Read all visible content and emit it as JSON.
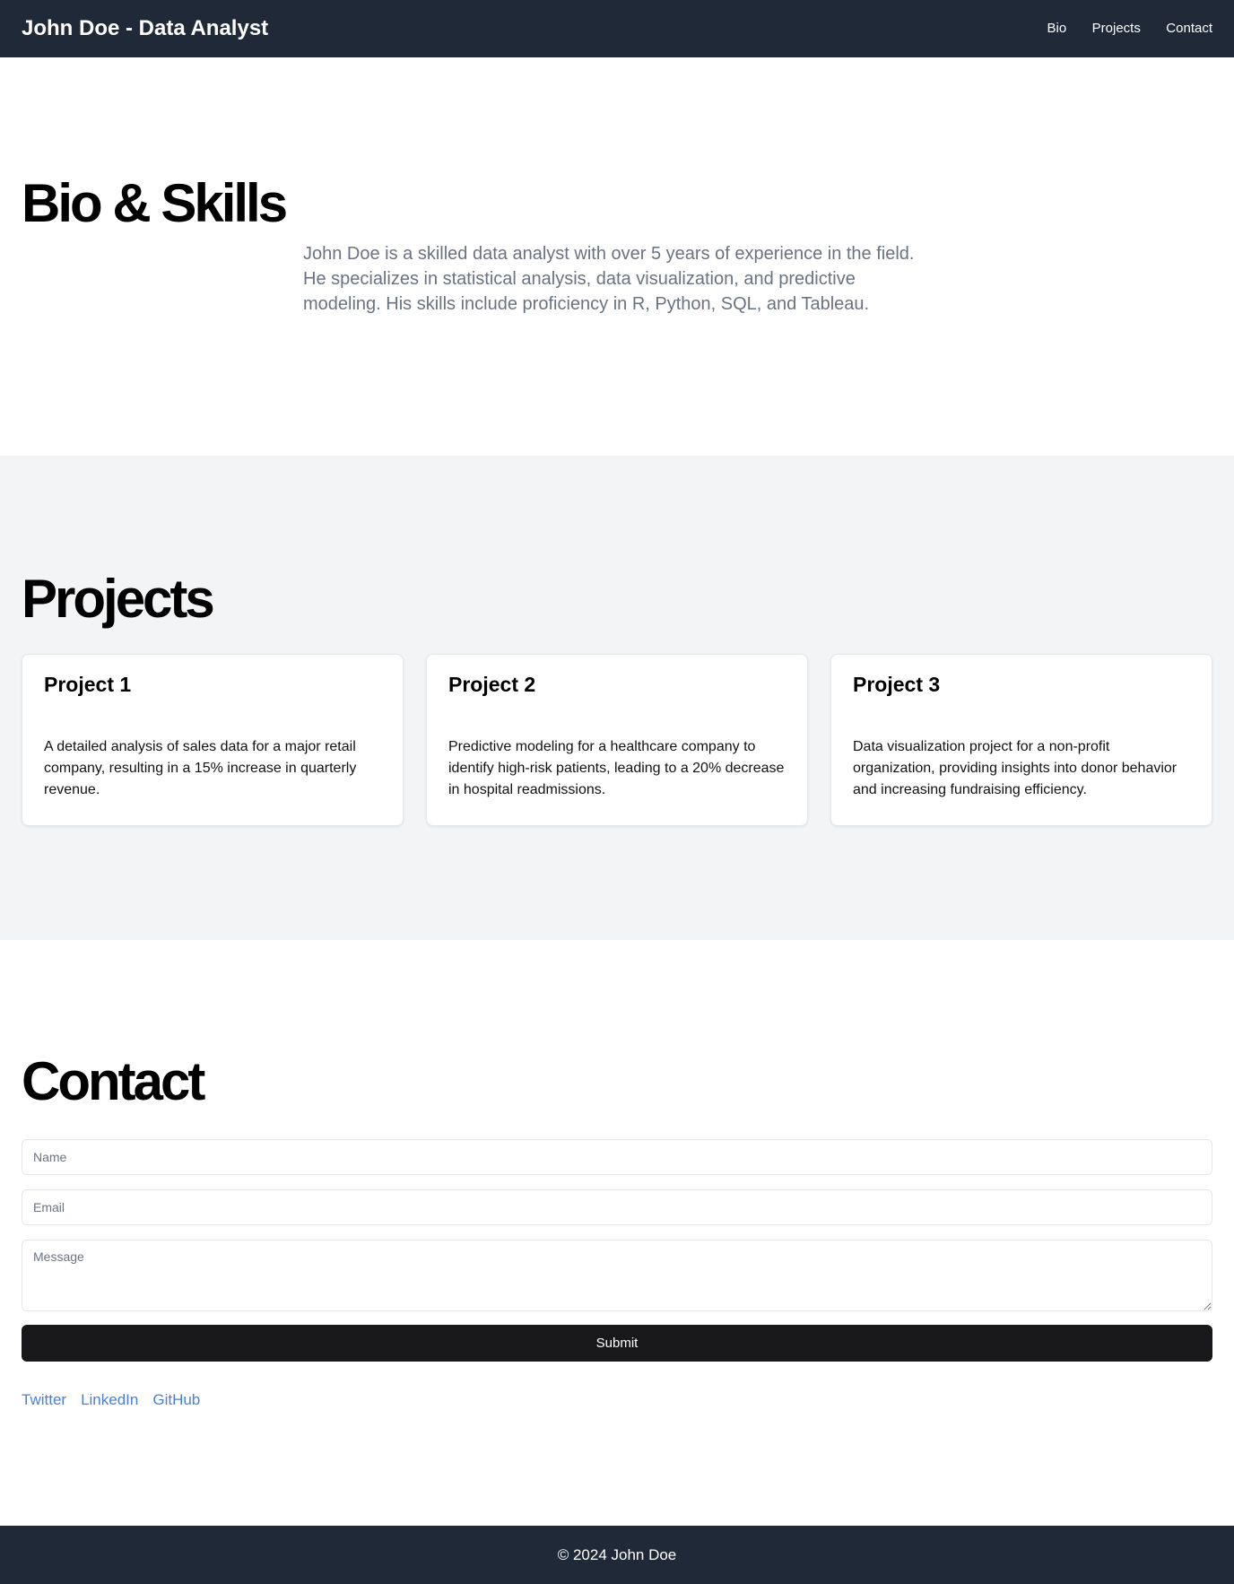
{
  "header": {
    "title": "John Doe - Data Analyst",
    "nav": [
      "Bio",
      "Projects",
      "Contact"
    ]
  },
  "bio": {
    "heading": "Bio & Skills",
    "text": "John Doe is a skilled data analyst with over 5 years of experience in the field. He specializes in statistical analysis, data visualization, and predictive modeling. His skills include proficiency in R, Python, SQL, and Tableau."
  },
  "projects": {
    "heading": "Projects",
    "items": [
      {
        "title": "Project 1",
        "text": "A detailed analysis of sales data for a major retail company, resulting in a 15% increase in quarterly revenue."
      },
      {
        "title": "Project 2",
        "text": "Predictive modeling for a healthcare company to identify high-risk patients, leading to a 20% decrease in hospital readmissions."
      },
      {
        "title": "Project 3",
        "text": "Data visualization project for a non-profit organization, providing insights into donor behavior and increasing fundraising efficiency."
      }
    ]
  },
  "contact": {
    "heading": "Contact",
    "name_placeholder": "Name",
    "email_placeholder": "Email",
    "message_placeholder": "Message",
    "submit": "Submit",
    "social": [
      "Twitter",
      "LinkedIn",
      "GitHub"
    ]
  },
  "footer": {
    "text": "© 2024 John Doe"
  }
}
